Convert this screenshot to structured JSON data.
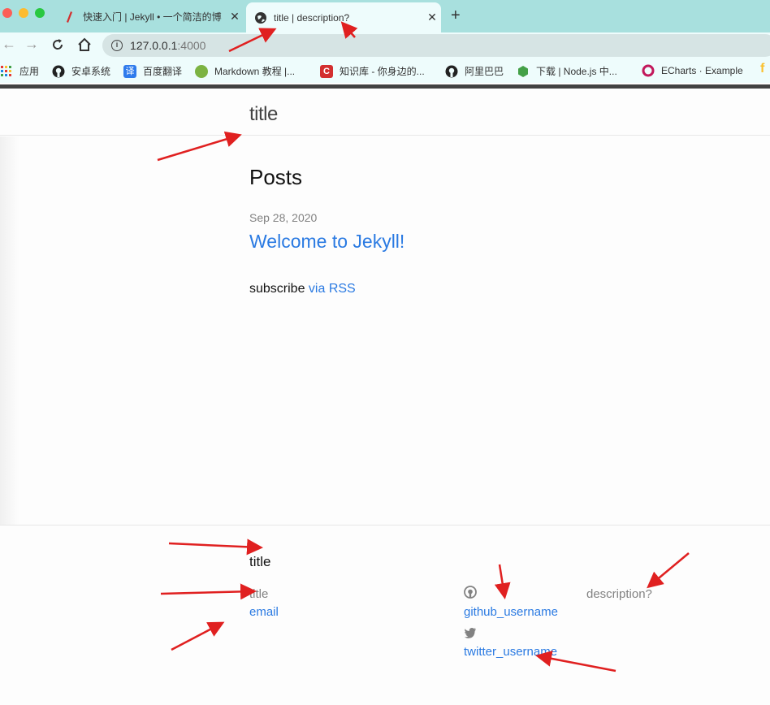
{
  "browser": {
    "tabs": [
      {
        "label": "快速入门 | Jekyll • 一个简洁的博",
        "active": false
      },
      {
        "label": "title | description?",
        "active": true
      }
    ],
    "new_tab": "+",
    "address": {
      "host": "127.0.0.1",
      "port": ":4000"
    },
    "bookmarks": [
      {
        "label": "应用",
        "icon": "apps-grid-icon"
      },
      {
        "label": "安卓系统",
        "icon": "github-icon"
      },
      {
        "label": "百度翻译",
        "icon": "translate-icon"
      },
      {
        "label": "Markdown 教程 |...",
        "icon": "runoob-icon"
      },
      {
        "label": "知识库 - 你身边的...",
        "icon": "csdn-icon"
      },
      {
        "label": "阿里巴巴",
        "icon": "github-icon"
      },
      {
        "label": "下载 | Node.js 中...",
        "icon": "nodejs-icon"
      },
      {
        "label": "ECharts · Example",
        "icon": "echarts-icon"
      }
    ]
  },
  "header": {
    "site_title": "title"
  },
  "main": {
    "heading": "Posts",
    "posts": [
      {
        "date": "Sep 28, 2020",
        "title": "Welcome to Jekyll!"
      }
    ],
    "subscribe_text": "subscribe ",
    "subscribe_link": "via RSS"
  },
  "footer": {
    "heading": "title",
    "name": "title",
    "email": "email",
    "github": "github_username",
    "twitter": "twitter_username",
    "description": "description?"
  },
  "colors": {
    "link": "#2a7ae2",
    "tabbar": "#a8e0de",
    "annotation_arrow": "#e02020"
  }
}
